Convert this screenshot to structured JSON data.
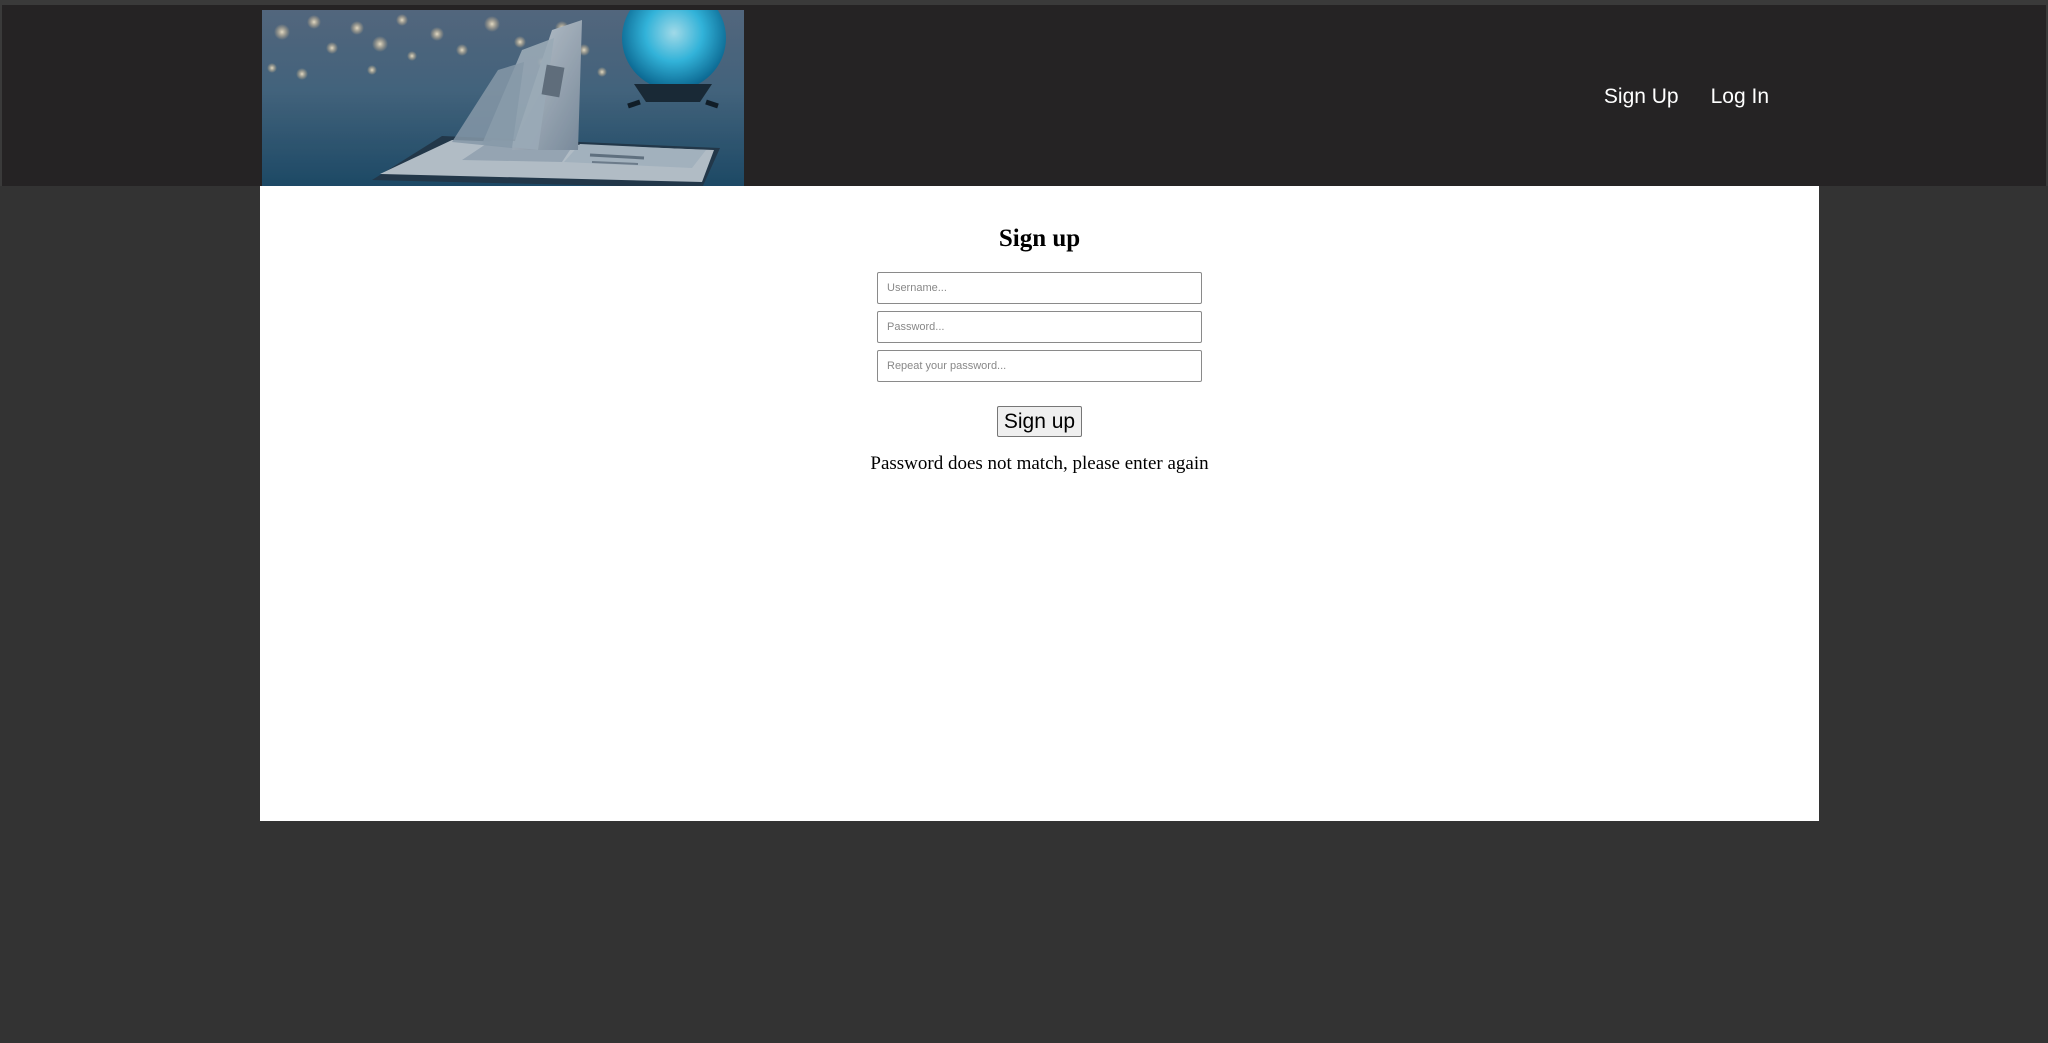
{
  "header": {
    "nav": {
      "signup_label": "Sign Up",
      "login_label": "Log In"
    }
  },
  "form": {
    "title": "Sign up",
    "username": {
      "placeholder": "Username...",
      "value": ""
    },
    "password": {
      "placeholder": "Password...",
      "value": ""
    },
    "repeat_password": {
      "placeholder": "Repeat your password...",
      "value": ""
    },
    "submit_label": "Sign up",
    "error_message": "Password does not match, please enter again"
  },
  "colors": {
    "page_background": "#333333",
    "header_background": "#252324",
    "content_background": "#ffffff",
    "nav_text": "#ffffff"
  },
  "icons": {
    "banner": "book-and-glowing-orb-banner-image"
  }
}
